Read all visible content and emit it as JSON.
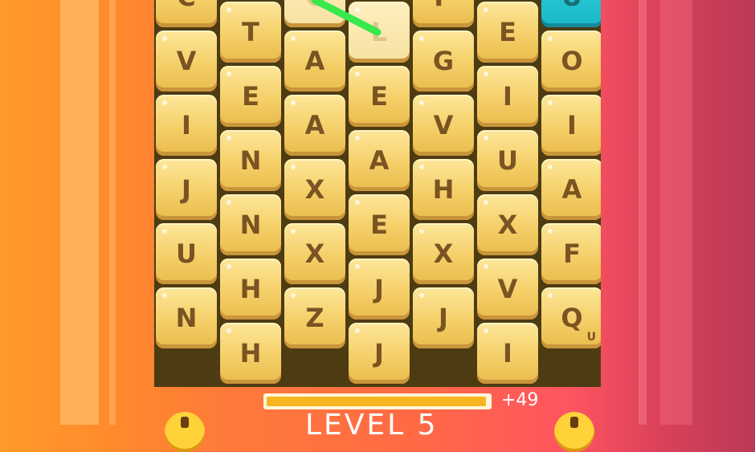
{
  "board": {
    "columns": [
      {
        "tiles": [
          {
            "letter": "C"
          },
          {
            "letter": "V"
          },
          {
            "letter": "I"
          },
          {
            "letter": "J"
          },
          {
            "letter": "U"
          },
          {
            "letter": "N"
          }
        ]
      },
      {
        "tiles": [
          {
            "letter": "T"
          },
          {
            "letter": "E"
          },
          {
            "letter": "N"
          },
          {
            "letter": "N"
          },
          {
            "letter": "H"
          },
          {
            "letter": "H"
          }
        ]
      },
      {
        "tiles": [
          {
            "letter": "C",
            "selected": true
          },
          {
            "letter": "A"
          },
          {
            "letter": "A"
          },
          {
            "letter": "X"
          },
          {
            "letter": "X"
          },
          {
            "letter": "Z"
          }
        ]
      },
      {
        "tiles": [
          {
            "letter": "L",
            "selected": true
          },
          {
            "letter": "E"
          },
          {
            "letter": "A"
          },
          {
            "letter": "E"
          },
          {
            "letter": "J"
          },
          {
            "letter": "J"
          }
        ]
      },
      {
        "tiles": [
          {
            "letter": "P"
          },
          {
            "letter": "G"
          },
          {
            "letter": "V"
          },
          {
            "letter": "H"
          },
          {
            "letter": "X"
          },
          {
            "letter": "J"
          }
        ]
      },
      {
        "tiles": [
          {
            "letter": "E"
          },
          {
            "letter": "I"
          },
          {
            "letter": "U"
          },
          {
            "letter": "X"
          },
          {
            "letter": "V"
          },
          {
            "letter": "I"
          }
        ]
      },
      {
        "tiles": [
          {
            "letter": "U",
            "special": true
          },
          {
            "letter": "O"
          },
          {
            "letter": "I"
          },
          {
            "letter": "A"
          },
          {
            "letter": "F"
          },
          {
            "letter": "Q",
            "sub": "U"
          }
        ]
      }
    ]
  },
  "progress": {
    "fraction": 0.99,
    "label": "+49"
  },
  "level": {
    "label": "LEVEL 5"
  },
  "colors": {
    "trail": "#39e84a",
    "special_tile": "#22c4d4",
    "progress_fill": "#f7b61f"
  },
  "icons": {
    "left_button": "hint-icon",
    "right_button": "shuffle-icon"
  }
}
